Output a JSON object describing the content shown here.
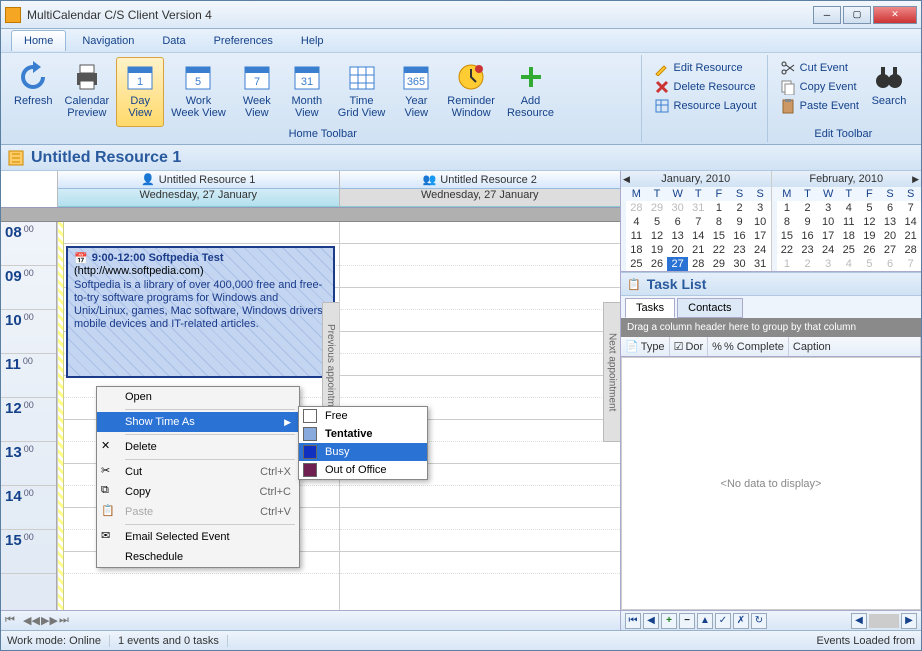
{
  "window": {
    "title": "MultiCalendar C/S Client Version 4"
  },
  "menu": {
    "items": [
      "Home",
      "Navigation",
      "Data",
      "Preferences",
      "Help"
    ],
    "active": 0
  },
  "ribbon": {
    "main": [
      {
        "label": "Refresh",
        "icon": "refresh"
      },
      {
        "label": "Calendar Preview",
        "icon": "printer"
      },
      {
        "label": "Day View",
        "icon": "cal-day",
        "sel": true
      },
      {
        "label": "Work Week View",
        "icon": "cal-ww"
      },
      {
        "label": "Week View",
        "icon": "cal-week"
      },
      {
        "label": "Month View",
        "icon": "cal-month"
      },
      {
        "label": "Time Grid View",
        "icon": "cal-grid"
      },
      {
        "label": "Year View",
        "icon": "cal-year"
      },
      {
        "label": "Reminder Window",
        "icon": "clock"
      },
      {
        "label": "Add Resource",
        "icon": "plus"
      }
    ],
    "mainCaption": "Home Toolbar",
    "resource": [
      {
        "label": "Edit Resource",
        "icon": "pencil"
      },
      {
        "label": "Delete Resource",
        "icon": "x-red"
      },
      {
        "label": "Resource Layout",
        "icon": "layout"
      }
    ],
    "edit": [
      {
        "label": "Cut Event",
        "icon": "scissors"
      },
      {
        "label": "Copy Event",
        "icon": "copy"
      },
      {
        "label": "Paste Event",
        "icon": "paste"
      }
    ],
    "editCaption": "Edit Toolbar",
    "search": {
      "label": "Search",
      "icon": "binoc"
    }
  },
  "resourceTitle": "Untitled Resource 1",
  "columns": [
    {
      "name": "Untitled Resource 1",
      "date": "Wednesday, 27 January"
    },
    {
      "name": "Untitled Resource 2",
      "date": "Wednesday, 27 January"
    }
  ],
  "hours": [
    "08",
    "09",
    "10",
    "11",
    "12",
    "13",
    "14",
    "15"
  ],
  "minute": "00",
  "event": {
    "time": "9:00-12:00 Softpedia Test",
    "url": "(http://www.softpedia.com)",
    "body": "Softpedia is a library of over 400,000 free and free-to-try software programs for Windows and Unix/Linux, games, Mac software, Windows drivers, mobile devices and IT-related articles."
  },
  "prevAppt": "Previous appointment",
  "nextAppt": "Next appointment",
  "ctx": {
    "open": "Open",
    "showTime": "Show Time As",
    "delete": "Delete",
    "cut": "Cut",
    "copy": "Copy",
    "paste": "Paste",
    "email": "Email Selected Event",
    "resched": "Reschedule",
    "sc_cut": "Ctrl+X",
    "sc_copy": "Ctrl+C",
    "sc_paste": "Ctrl+V",
    "sub": [
      {
        "label": "Free",
        "color": "#fff"
      },
      {
        "label": "Tentative",
        "color": "#88aadd",
        "bold": true
      },
      {
        "label": "Busy",
        "color": "#1030c0",
        "hl": true
      },
      {
        "label": "Out of Office",
        "color": "#702050"
      }
    ]
  },
  "minical1": {
    "title": "January, 2010",
    "dows": [
      "M",
      "T",
      "W",
      "T",
      "F",
      "S",
      "S"
    ],
    "rows": [
      {
        "wk": "",
        "d": [
          {
            "v": 28,
            "dim": 1
          },
          {
            "v": 29,
            "dim": 1
          },
          {
            "v": 30,
            "dim": 1
          },
          {
            "v": 31,
            "dim": 1
          },
          {
            "v": 1
          },
          {
            "v": 2
          },
          {
            "v": 3
          }
        ]
      },
      {
        "wk": "",
        "d": [
          {
            "v": 4
          },
          {
            "v": 5
          },
          {
            "v": 6
          },
          {
            "v": 7
          },
          {
            "v": 8
          },
          {
            "v": 9
          },
          {
            "v": 10
          }
        ]
      },
      {
        "wk": "",
        "d": [
          {
            "v": 11
          },
          {
            "v": 12
          },
          {
            "v": 13
          },
          {
            "v": 14
          },
          {
            "v": 15
          },
          {
            "v": 16
          },
          {
            "v": 17
          }
        ]
      },
      {
        "wk": "",
        "d": [
          {
            "v": 18
          },
          {
            "v": 19
          },
          {
            "v": 20
          },
          {
            "v": 21
          },
          {
            "v": 22
          },
          {
            "v": 23
          },
          {
            "v": 24
          }
        ]
      },
      {
        "wk": "",
        "d": [
          {
            "v": 25
          },
          {
            "v": 26
          },
          {
            "v": 27,
            "today": 1
          },
          {
            "v": 28
          },
          {
            "v": 29
          },
          {
            "v": 30
          },
          {
            "v": 31
          }
        ]
      }
    ]
  },
  "minical2": {
    "title": "February, 2010",
    "dows": [
      "M",
      "T",
      "W",
      "T",
      "F",
      "S",
      "S"
    ],
    "rows": [
      {
        "wk": "",
        "d": [
          {
            "v": 1
          },
          {
            "v": 2
          },
          {
            "v": 3
          },
          {
            "v": 4
          },
          {
            "v": 5
          },
          {
            "v": 6
          },
          {
            "v": 7
          }
        ]
      },
      {
        "wk": "",
        "d": [
          {
            "v": 8
          },
          {
            "v": 9
          },
          {
            "v": 10
          },
          {
            "v": 11
          },
          {
            "v": 12
          },
          {
            "v": 13
          },
          {
            "v": 14
          }
        ]
      },
      {
        "wk": "",
        "d": [
          {
            "v": 15
          },
          {
            "v": 16
          },
          {
            "v": 17
          },
          {
            "v": 18
          },
          {
            "v": 19
          },
          {
            "v": 20
          },
          {
            "v": 21
          }
        ]
      },
      {
        "wk": "",
        "d": [
          {
            "v": 22
          },
          {
            "v": 23
          },
          {
            "v": 24
          },
          {
            "v": 25
          },
          {
            "v": 26
          },
          {
            "v": 27
          },
          {
            "v": 28
          }
        ]
      },
      {
        "wk": "",
        "d": [
          {
            "v": 1,
            "dim": 1
          },
          {
            "v": 2,
            "dim": 1
          },
          {
            "v": 3,
            "dim": 1
          },
          {
            "v": 4,
            "dim": 1
          },
          {
            "v": 5,
            "dim": 1
          },
          {
            "v": 6,
            "dim": 1
          },
          {
            "v": 7,
            "dim": 1
          }
        ]
      }
    ]
  },
  "taskList": {
    "title": "Task List",
    "tabs": [
      "Tasks",
      "Contacts"
    ],
    "activeTab": 0,
    "groupHint": "Drag a column header here to group by that column",
    "cols": [
      "Type",
      "Dor",
      "% Complete",
      "Caption"
    ],
    "empty": "<No data to display>"
  },
  "status": {
    "mode": "Work mode: Online",
    "events": "1 events and 0 tasks",
    "loaded": "Events Loaded from"
  }
}
